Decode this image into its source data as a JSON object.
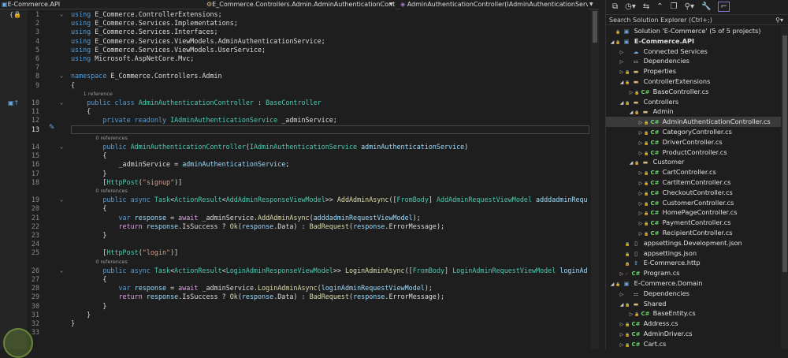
{
  "topbar": {
    "project": "E-Commerce.API",
    "namespace": "E_Commerce.Controllers.Admin.AdminAuthenticationController",
    "member": "AdminAuthenticationController(IAdminAuthenticationService ac"
  },
  "editor": {
    "current_line": 13,
    "lines": [
      {
        "n": 1,
        "fold": "⌄",
        "t": [
          [
            "kw",
            "using "
          ],
          [
            "tx",
            "E_Commerce.ControllerExtensions;"
          ]
        ]
      },
      {
        "n": 2,
        "t": [
          [
            "kw",
            "using "
          ],
          [
            "tx",
            "E_Commerce.Services.Implementations;"
          ]
        ]
      },
      {
        "n": 3,
        "t": [
          [
            "kw",
            "using "
          ],
          [
            "tx",
            "E_Commerce.Services.Interfaces;"
          ]
        ]
      },
      {
        "n": 4,
        "t": [
          [
            "kw",
            "using "
          ],
          [
            "tx",
            "E_Commerce.Services.ViewModels.AdminAuthenticationService;"
          ]
        ]
      },
      {
        "n": 5,
        "t": [
          [
            "kw",
            "using "
          ],
          [
            "tx",
            "E_Commerce.Services.ViewModels.UserService;"
          ]
        ]
      },
      {
        "n": 6,
        "t": [
          [
            "kw",
            "using "
          ],
          [
            "tx",
            "Microsoft.AspNetCore.Mvc;"
          ]
        ]
      },
      {
        "n": 7,
        "t": []
      },
      {
        "n": 8,
        "fold": "⌄",
        "t": [
          [
            "kw",
            "namespace "
          ],
          [
            "tx",
            "E_Commerce.Controllers.Admin"
          ]
        ]
      },
      {
        "n": 9,
        "t": [
          [
            "tx",
            "{"
          ]
        ]
      },
      {
        "lens": "1 reference",
        "indent": "    "
      },
      {
        "n": 10,
        "fold": "⌄",
        "t": [
          [
            "tx",
            "    "
          ],
          [
            "kw",
            "public class "
          ],
          [
            "ty",
            "AdminAuthenticationController"
          ],
          [
            "tx",
            " : "
          ],
          [
            "ty",
            "BaseController"
          ]
        ]
      },
      {
        "n": 11,
        "t": [
          [
            "tx",
            "    {"
          ]
        ]
      },
      {
        "n": 12,
        "t": [
          [
            "tx",
            "        "
          ],
          [
            "kw",
            "private readonly "
          ],
          [
            "ty",
            "IAdminAuthenticationService "
          ],
          [
            "tx",
            "_adminService;"
          ]
        ]
      },
      {
        "n": 13,
        "t": []
      },
      {
        "lens": "0 references",
        "indent": "        "
      },
      {
        "n": 14,
        "fold": "⌄",
        "t": [
          [
            "tx",
            "        "
          ],
          [
            "kw",
            "public "
          ],
          [
            "ty",
            "AdminAuthenticationController"
          ],
          [
            "tx",
            "("
          ],
          [
            "ty",
            "IAdminAuthenticationService "
          ],
          [
            "va",
            "adminAuthenticationService"
          ],
          [
            "tx",
            ")"
          ]
        ]
      },
      {
        "n": 15,
        "t": [
          [
            "tx",
            "        {"
          ]
        ]
      },
      {
        "n": 16,
        "t": [
          [
            "tx",
            "            _adminService = "
          ],
          [
            "va",
            "adminAuthenticationService"
          ],
          [
            "tx",
            ";"
          ]
        ]
      },
      {
        "n": 17,
        "t": [
          [
            "tx",
            "        }"
          ]
        ]
      },
      {
        "n": 18,
        "t": [
          [
            "tx",
            "        ["
          ],
          [
            "ty",
            "HttpPost"
          ],
          [
            "tx",
            "("
          ],
          [
            "st",
            "\"signup\""
          ],
          [
            "tx",
            ")]"
          ]
        ]
      },
      {
        "lens": "0 references",
        "indent": "        "
      },
      {
        "n": 19,
        "fold": "⌄",
        "t": [
          [
            "tx",
            "        "
          ],
          [
            "kw",
            "public async "
          ],
          [
            "ty",
            "Task"
          ],
          [
            "tx",
            "<"
          ],
          [
            "ty",
            "ActionResult"
          ],
          [
            "tx",
            "<"
          ],
          [
            "ty",
            "AddAdminResponseViewModel"
          ],
          [
            "tx",
            ">> "
          ],
          [
            "fn",
            "AddAdminAsync"
          ],
          [
            "tx",
            "(["
          ],
          [
            "ty",
            "FromBody"
          ],
          [
            "tx",
            "] "
          ],
          [
            "ty",
            "AddAdminRequestViewModel "
          ],
          [
            "va",
            "adddadminRequ"
          ]
        ]
      },
      {
        "n": 20,
        "t": [
          [
            "tx",
            "        {"
          ]
        ]
      },
      {
        "n": 21,
        "t": [
          [
            "tx",
            "            "
          ],
          [
            "kw",
            "var "
          ],
          [
            "va",
            "response"
          ],
          [
            "tx",
            " = "
          ],
          [
            "ct",
            "await "
          ],
          [
            "tx",
            "_adminService."
          ],
          [
            "fn",
            "AddAdminAsync"
          ],
          [
            "tx",
            "("
          ],
          [
            "va",
            "adddadminRequestViewModel"
          ],
          [
            "tx",
            ");"
          ]
        ]
      },
      {
        "n": 22,
        "t": [
          [
            "tx",
            "            "
          ],
          [
            "ct",
            "return "
          ],
          [
            "va",
            "response"
          ],
          [
            "tx",
            ".IsSuccess ? "
          ],
          [
            "fn",
            "Ok"
          ],
          [
            "tx",
            "("
          ],
          [
            "va",
            "response"
          ],
          [
            "tx",
            ".Data) : "
          ],
          [
            "fn",
            "BadRequest"
          ],
          [
            "tx",
            "("
          ],
          [
            "va",
            "response"
          ],
          [
            "tx",
            ".ErrorMessage);"
          ]
        ]
      },
      {
        "n": 23,
        "t": [
          [
            "tx",
            "        }"
          ]
        ]
      },
      {
        "n": 24,
        "t": []
      },
      {
        "n": 25,
        "t": [
          [
            "tx",
            "        ["
          ],
          [
            "ty",
            "HttpPost"
          ],
          [
            "tx",
            "("
          ],
          [
            "st",
            "\"login\""
          ],
          [
            "tx",
            ")]"
          ]
        ]
      },
      {
        "lens": "0 references",
        "indent": "        "
      },
      {
        "n": 26,
        "fold": "⌄",
        "t": [
          [
            "tx",
            "        "
          ],
          [
            "kw",
            "public async "
          ],
          [
            "ty",
            "Task"
          ],
          [
            "tx",
            "<"
          ],
          [
            "ty",
            "ActionResult"
          ],
          [
            "tx",
            "<"
          ],
          [
            "ty",
            "LoginAdminResponseViewModel"
          ],
          [
            "tx",
            ">> "
          ],
          [
            "fn",
            "LoginAdminAsync"
          ],
          [
            "tx",
            "(["
          ],
          [
            "ty",
            "FromBody"
          ],
          [
            "tx",
            "] "
          ],
          [
            "ty",
            "LoginAdminRequestViewModel "
          ],
          [
            "va",
            "loginAd"
          ]
        ]
      },
      {
        "n": 27,
        "t": [
          [
            "tx",
            "        {"
          ]
        ]
      },
      {
        "n": 28,
        "t": [
          [
            "tx",
            "            "
          ],
          [
            "kw",
            "var "
          ],
          [
            "va",
            "response"
          ],
          [
            "tx",
            " = "
          ],
          [
            "ct",
            "await "
          ],
          [
            "tx",
            "_adminService."
          ],
          [
            "fn",
            "LoginAdminAsync"
          ],
          [
            "tx",
            "("
          ],
          [
            "va",
            "loginAdminRequestViewModel"
          ],
          [
            "tx",
            ");"
          ]
        ]
      },
      {
        "n": 29,
        "t": [
          [
            "tx",
            "            "
          ],
          [
            "ct",
            "return "
          ],
          [
            "va",
            "response"
          ],
          [
            "tx",
            ".IsSuccess ? "
          ],
          [
            "fn",
            "Ok"
          ],
          [
            "tx",
            "("
          ],
          [
            "va",
            "response"
          ],
          [
            "tx",
            ".Data) : "
          ],
          [
            "fn",
            "BadRequest"
          ],
          [
            "tx",
            "("
          ],
          [
            "va",
            "response"
          ],
          [
            "tx",
            ".ErrorMessage);"
          ]
        ]
      },
      {
        "n": 30,
        "t": [
          [
            "tx",
            "        }"
          ]
        ]
      },
      {
        "n": 31,
        "t": [
          [
            "tx",
            "    }"
          ]
        ]
      },
      {
        "n": 32,
        "t": [
          [
            "tx",
            "}"
          ]
        ]
      },
      {
        "n": 33,
        "t": []
      }
    ]
  },
  "solution_explorer": {
    "search_placeholder": "Search Solution Explorer (Ctrl+;)",
    "items": [
      {
        "label": "Solution 'E-Commerce' (5 of 5 projects)",
        "lvl": 0,
        "ex": "",
        "icon": "sln",
        "lock": true
      },
      {
        "label": "E-Commerce.API",
        "lvl": 0,
        "ex": "◢",
        "icon": "proj",
        "lock": true,
        "bold": true
      },
      {
        "label": "Connected Services",
        "lvl": 1,
        "ex": "▷",
        "icon": "svc"
      },
      {
        "label": "Dependencies",
        "lvl": 1,
        "ex": "▷",
        "icon": "dep"
      },
      {
        "label": "Properties",
        "lvl": 1,
        "ex": "▷",
        "icon": "fo",
        "lock": true
      },
      {
        "label": "ControllerExtensions",
        "lvl": 1,
        "ex": "◢",
        "icon": "fo",
        "lock": true
      },
      {
        "label": "BaseController.cs",
        "lvl": 2,
        "ex": "▷",
        "icon": "cs",
        "lock": true
      },
      {
        "label": "Controllers",
        "lvl": 1,
        "ex": "◢",
        "icon": "fo",
        "lock": true
      },
      {
        "label": "Admin",
        "lvl": 2,
        "ex": "◢",
        "icon": "fo",
        "lock": true
      },
      {
        "label": "AdminAuthenticationController.cs",
        "lvl": 3,
        "ex": "▷",
        "icon": "cs",
        "lock": true,
        "sel": true
      },
      {
        "label": "CategoryController.cs",
        "lvl": 3,
        "ex": "▷",
        "icon": "cs",
        "lock": true
      },
      {
        "label": "DriverController.cs",
        "lvl": 3,
        "ex": "▷",
        "icon": "cs",
        "lock": true
      },
      {
        "label": "ProductController.cs",
        "lvl": 3,
        "ex": "▷",
        "icon": "cs",
        "lock": true
      },
      {
        "label": "Customer",
        "lvl": 2,
        "ex": "◢",
        "icon": "fo",
        "lock": true
      },
      {
        "label": "CartController.cs",
        "lvl": 3,
        "ex": "▷",
        "icon": "cs",
        "lock": true
      },
      {
        "label": "CartItemController.cs",
        "lvl": 3,
        "ex": "▷",
        "icon": "cs",
        "lock": true
      },
      {
        "label": "CheckoutController.cs",
        "lvl": 3,
        "ex": "▷",
        "icon": "cs",
        "lock": true
      },
      {
        "label": "CustomerController.cs",
        "lvl": 3,
        "ex": "▷",
        "icon": "cs",
        "lock": true
      },
      {
        "label": "HomePageController.cs",
        "lvl": 3,
        "ex": "▷",
        "icon": "cs",
        "lock": true
      },
      {
        "label": "PaymentController.cs",
        "lvl": 3,
        "ex": "▷",
        "icon": "cs",
        "lock": true
      },
      {
        "label": "RecipientController.cs",
        "lvl": 3,
        "ex": "▷",
        "icon": "cs",
        "lock": true
      },
      {
        "label": "appsettings.Development.json",
        "lvl": 1,
        "ex": "",
        "icon": "js",
        "lock": true
      },
      {
        "label": "appsettings.json",
        "lvl": 1,
        "ex": "",
        "icon": "js",
        "lock": true
      },
      {
        "label": "E-Commerce.http",
        "lvl": 1,
        "ex": "",
        "icon": "http",
        "lock": true
      },
      {
        "label": "Program.cs",
        "lvl": 1,
        "ex": "▷",
        "icon": "cs",
        "check": true
      },
      {
        "label": "E-Commerce.Domain",
        "lvl": 0,
        "ex": "◢",
        "icon": "proj",
        "lock": true
      },
      {
        "label": "Dependencies",
        "lvl": 1,
        "ex": "▷",
        "icon": "dep"
      },
      {
        "label": "Shared",
        "lvl": 1,
        "ex": "◢",
        "icon": "fo",
        "lock": true
      },
      {
        "label": "BaseEntity.cs",
        "lvl": 2,
        "ex": "▷",
        "icon": "cs",
        "lock": true
      },
      {
        "label": "Address.cs",
        "lvl": 1,
        "ex": "▷",
        "icon": "cs",
        "lock": true
      },
      {
        "label": "AdminDriver.cs",
        "lvl": 1,
        "ex": "▷",
        "icon": "cs",
        "lock": true
      },
      {
        "label": "Cart.cs",
        "lvl": 1,
        "ex": "▷",
        "icon": "cs",
        "lock": true
      }
    ]
  }
}
